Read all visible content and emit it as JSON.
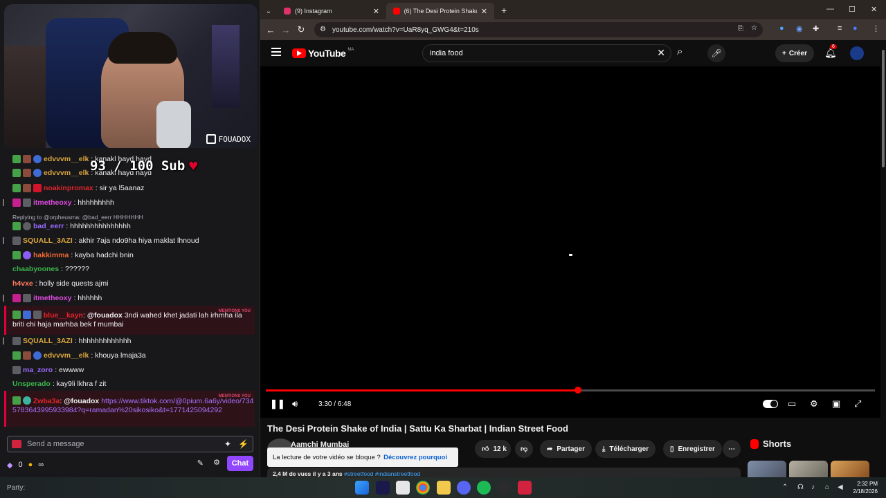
{
  "twitch": {
    "cam_logo": "FOUADOX",
    "sub_goal": "93 / 100 Sub",
    "chat": [
      {
        "user": "edvvvm__elk",
        "text": ": kanakl hayd hayd",
        "color": "#d9a43d"
      },
      {
        "user": "edvvvm__elk",
        "text": ": kanakl hayd hayd",
        "color": "#d9a43d"
      },
      {
        "user": "noakinpromax",
        "text": ": sir ya l5aanaz",
        "color": "#e0242b"
      },
      {
        "user": "itmetheoxy",
        "text": ": hhhhhhhhh",
        "color": "#e04ae0"
      },
      {
        "reply": "Replying to @orpheusma: @bad_eerr HHHHHHH"
      },
      {
        "user": "bad_eerr",
        "text": ": hhhhhhhhhhhhhhh",
        "color": "#9b6cff"
      },
      {
        "user": "SQUALL_3AZI",
        "text": ": akhir 7aja ndo9ha hiya maklat lhnoud",
        "color": "#d9a43d"
      },
      {
        "user": "hakkimma",
        "text": ": kayba hadchi bnin",
        "color": "#f06a30"
      },
      {
        "user": "chaabyoones",
        "text": ": ??????",
        "color": "#3bb34a"
      },
      {
        "user": "h4vxe",
        "text": ": holly side quests ajmi",
        "color": "#ff7a5a"
      },
      {
        "user": "itmetheoxy",
        "text": ": hhhhhh",
        "color": "#e04ae0"
      },
      {
        "user": "blue__kayn",
        "mention": "@fouadox",
        "text": " 3ndi wahed khet jadati lah irhmha ila briti chi haja marhba bek f mumbai",
        "color": "#e0242b"
      },
      {
        "user": "SQUALL_3AZI",
        "text": ": hhhhhhhhhhhhh",
        "color": "#d9a43d"
      },
      {
        "user": "edvvvm__elk",
        "text": ": khouya lmaja3a",
        "color": "#d9a43d"
      },
      {
        "user": "ma_zoro",
        "text": ": ewwww",
        "color": "#9b6cff"
      },
      {
        "user": "Unsperado",
        "text": ": kay9li lkhra f zit",
        "color": "#3bb34a"
      },
      {
        "user": "Zwba3a",
        "mention": "@fouadox",
        "link": "https://www.tiktok.com/@0pium.6a6y/video/7345783643995933984?q=ramadan%20sikosiko&t=1771425094292",
        "color": "#e0242b"
      }
    ],
    "mentions_tag": "MENTIONS YOU",
    "input_placeholder": "Send a message",
    "points": "0",
    "infinity": "∞",
    "chat_button": "Chat"
  },
  "chrome": {
    "tabs": [
      {
        "label": "(9) Instagram",
        "color": "#e1306c"
      },
      {
        "label": "(6) The Desi Protein Shake of Ir",
        "color": "#ff0000"
      }
    ],
    "url": "youtube.com/watch?v=UaR8yq_GWG4&t=210s"
  },
  "youtube": {
    "logo": "YouTube",
    "logo_country": "MA",
    "search_value": "india food",
    "create_label": "Créer",
    "notif_count": "6",
    "progress_fraction": 0.5128,
    "time": "3:30 / 6:48",
    "title": "The Desi Protein Shake of India | Sattu Ka Sharbat | Indian Street Food",
    "channel": "Aamchi Mumbai",
    "likes": "12 k",
    "share_label": "Partager",
    "download_label": "Télécharger",
    "save_label": "Enregistrer",
    "tooltip_text": "La lecture de votre vidéo se bloque ?",
    "tooltip_link": "Découvrez pourquoi",
    "views_line": "2,4 M de vues  il y a 3 ans ",
    "tags_line": "#streetfood #indianstreetfood",
    "shorts_label": "Shorts"
  },
  "taskbar": {
    "party": "Party:",
    "time": "2:32 PM",
    "date": "2/18/2026"
  }
}
